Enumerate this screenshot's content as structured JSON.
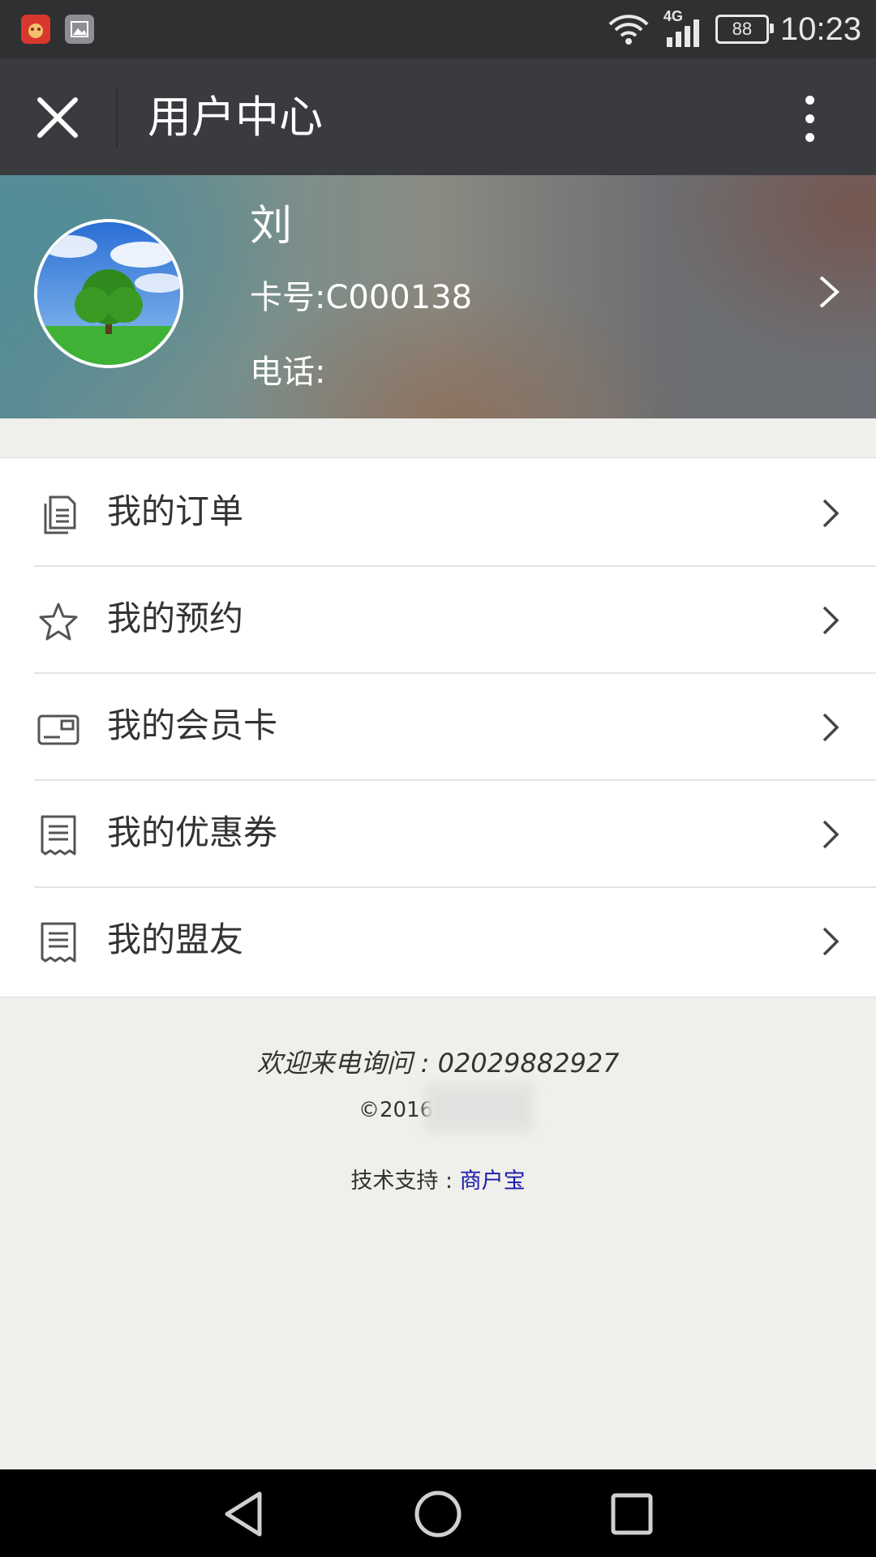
{
  "status_bar": {
    "time": "10:23",
    "battery": "88",
    "network": "4G",
    "icons": [
      "app-notification-icon",
      "gallery-notification-icon",
      "wifi-icon",
      "signal-icon",
      "battery-icon"
    ]
  },
  "title_bar": {
    "title": "用户中心",
    "close_icon": "close-icon",
    "more_icon": "more-vertical-icon"
  },
  "profile": {
    "name": "刘",
    "card_number": "卡号:C000138",
    "phone": "电话:"
  },
  "menu": [
    {
      "label": "我的订单",
      "icon": "document-icon"
    },
    {
      "label": "我的预约",
      "icon": "star-icon"
    },
    {
      "label": "我的会员卡",
      "icon": "card-icon"
    },
    {
      "label": "我的优惠券",
      "icon": "receipt-icon"
    },
    {
      "label": "我的盟友",
      "icon": "receipt-icon"
    }
  ],
  "footer": {
    "contact": "欢迎来电询问 : 02029882927",
    "copyright": "©2016",
    "support_prefix": "技术支持 : ",
    "support_link": "商户宝"
  },
  "colors": {
    "status_bar_bg": "#2e3032",
    "title_bar_bg": "#3a3b3f",
    "page_bg": "#efefeb",
    "link": "#1a1aaa"
  }
}
